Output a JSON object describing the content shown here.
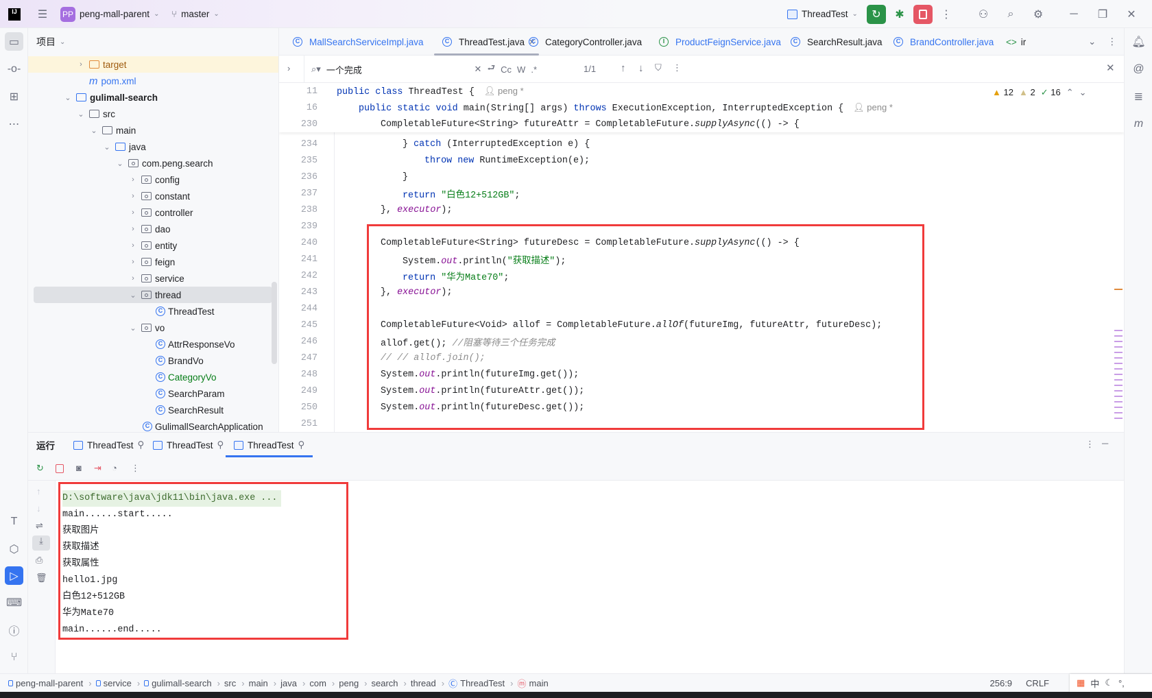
{
  "titlebar": {
    "project_badge": "PP",
    "project": "peng-mall-parent",
    "branch": "master",
    "run_config": "ThreadTest"
  },
  "project_panel": {
    "title": "项目",
    "tree": [
      {
        "label": "target",
        "depth": 1,
        "arrow": "›",
        "icon": "folder-orange",
        "hl": true,
        "color": "#9e5a0d"
      },
      {
        "label": "pom.xml",
        "depth": 1,
        "arrow": "",
        "icon": "maven",
        "color": "#3574f0"
      },
      {
        "label": "gulimall-search",
        "depth": 0,
        "arrow": "⌄",
        "icon": "module",
        "bold": true
      },
      {
        "label": "src",
        "depth": 1,
        "arrow": "⌄",
        "icon": "folder"
      },
      {
        "label": "main",
        "depth": 2,
        "arrow": "⌄",
        "icon": "folder"
      },
      {
        "label": "java",
        "depth": 3,
        "arrow": "⌄",
        "icon": "folder-blue"
      },
      {
        "label": "com.peng.search",
        "depth": 4,
        "arrow": "⌄",
        "icon": "package"
      },
      {
        "label": "config",
        "depth": 5,
        "arrow": "›",
        "icon": "package"
      },
      {
        "label": "constant",
        "depth": 5,
        "arrow": "›",
        "icon": "package"
      },
      {
        "label": "controller",
        "depth": 5,
        "arrow": "›",
        "icon": "package"
      },
      {
        "label": "dao",
        "depth": 5,
        "arrow": "›",
        "icon": "package"
      },
      {
        "label": "entity",
        "depth": 5,
        "arrow": "›",
        "icon": "package"
      },
      {
        "label": "feign",
        "depth": 5,
        "arrow": "›",
        "icon": "package"
      },
      {
        "label": "service",
        "depth": 5,
        "arrow": "›",
        "icon": "package"
      },
      {
        "label": "thread",
        "depth": 5,
        "arrow": "⌄",
        "icon": "package",
        "selected": true
      },
      {
        "label": "ThreadTest",
        "depth": 6,
        "arrow": "",
        "icon": "class-run"
      },
      {
        "label": "vo",
        "depth": 5,
        "arrow": "⌄",
        "icon": "package"
      },
      {
        "label": "AttrResponseVo",
        "depth": 6,
        "arrow": "",
        "icon": "class"
      },
      {
        "label": "BrandVo",
        "depth": 6,
        "arrow": "",
        "icon": "class"
      },
      {
        "label": "CategoryVo",
        "depth": 6,
        "arrow": "",
        "icon": "class",
        "color": "#067d17"
      },
      {
        "label": "SearchParam",
        "depth": 6,
        "arrow": "",
        "icon": "class"
      },
      {
        "label": "SearchResult",
        "depth": 6,
        "arrow": "",
        "icon": "class"
      },
      {
        "label": "GulimallSearchApplication",
        "depth": 5,
        "arrow": "",
        "icon": "class-run"
      }
    ]
  },
  "tabs": [
    {
      "label": "MallSearchServiceImpl.java",
      "icon": "class",
      "color": "#3574f0"
    },
    {
      "label": "ThreadTest.java",
      "icon": "class-run",
      "active": true
    },
    {
      "label": "CategoryController.java",
      "icon": "class"
    },
    {
      "label": "ProductFeignService.java",
      "icon": "interface",
      "color": "#3574f0"
    },
    {
      "label": "SearchResult.java",
      "icon": "class"
    },
    {
      "label": "BrandController.java",
      "icon": "class",
      "color": "#3574f0"
    },
    {
      "label": "ir",
      "icon": "html"
    }
  ],
  "find": {
    "query": "一个完成",
    "case": "Cc",
    "word": "W",
    "regex": ".*",
    "count": "1/1"
  },
  "inspections": {
    "warnings": "12",
    "weak": "2",
    "ok": "16"
  },
  "sticky": [
    {
      "n": "11",
      "indent": 0,
      "t": [
        [
          "public class ",
          "k"
        ],
        [
          "ThreadTest {",
          ""
        ]
      ],
      "author": "peng *"
    },
    {
      "n": "16",
      "indent": 1,
      "t": [
        [
          "public static void ",
          "k"
        ],
        [
          "main",
          ""
        ],
        [
          "(String[] args) ",
          ""
        ],
        [
          "throws ",
          "k"
        ],
        [
          "ExecutionException, InterruptedException {",
          ""
        ]
      ],
      "author": "peng *"
    },
    {
      "n": "230",
      "indent": 2,
      "t": [
        [
          "CompletableFuture<String> futureAttr = CompletableFuture.",
          ""
        ],
        [
          "supplyAsync",
          "i"
        ],
        [
          "(() -> {",
          ""
        ]
      ]
    }
  ],
  "code": [
    {
      "n": "234",
      "indent": 3,
      "t": [
        [
          "} ",
          ""
        ],
        [
          "catch ",
          "k"
        ],
        [
          "(InterruptedException e) {",
          ""
        ]
      ]
    },
    {
      "n": "235",
      "indent": 4,
      "t": [
        [
          "throw new ",
          "k"
        ],
        [
          "RuntimeException(e);",
          ""
        ]
      ]
    },
    {
      "n": "236",
      "indent": 3,
      "t": [
        [
          "}",
          ""
        ]
      ]
    },
    {
      "n": "237",
      "indent": 3,
      "t": [
        [
          "return ",
          "k"
        ],
        [
          "\"白色12+512GB\"",
          "s"
        ],
        [
          ";",
          ""
        ]
      ]
    },
    {
      "n": "238",
      "indent": 2,
      "t": [
        [
          "}, ",
          ""
        ],
        [
          "executor",
          "f"
        ],
        [
          ");",
          ""
        ]
      ]
    },
    {
      "n": "239",
      "indent": 2,
      "t": []
    },
    {
      "n": "240",
      "indent": 2,
      "t": [
        [
          "CompletableFuture<String> futureDesc = CompletableFuture.",
          ""
        ],
        [
          "supplyAsync",
          "i"
        ],
        [
          "(() -> {",
          ""
        ]
      ]
    },
    {
      "n": "241",
      "indent": 3,
      "t": [
        [
          "System.",
          ""
        ],
        [
          "out",
          "f"
        ],
        [
          ".println(",
          ""
        ],
        [
          "\"获取描述\"",
          "s"
        ],
        [
          ");",
          ""
        ]
      ]
    },
    {
      "n": "242",
      "indent": 3,
      "t": [
        [
          "return ",
          "k"
        ],
        [
          "\"华为Mate70\"",
          "s"
        ],
        [
          ";",
          ""
        ]
      ]
    },
    {
      "n": "243",
      "indent": 2,
      "t": [
        [
          "}, ",
          ""
        ],
        [
          "executor",
          "f"
        ],
        [
          ");",
          ""
        ]
      ]
    },
    {
      "n": "244",
      "indent": 2,
      "t": []
    },
    {
      "n": "245",
      "indent": 2,
      "t": [
        [
          "CompletableFuture<Void> allof = CompletableFuture.",
          ""
        ],
        [
          "allOf",
          "i"
        ],
        [
          "(futureImg, futureAttr, futureDesc);",
          ""
        ]
      ]
    },
    {
      "n": "246",
      "indent": 2,
      "t": [
        [
          "allof.get(); ",
          ""
        ],
        [
          "//阻塞等待三个任务完成",
          "c"
        ]
      ]
    },
    {
      "n": "247",
      "indent": 2,
      "t": [
        [
          "// // allof.join();",
          "c"
        ]
      ]
    },
    {
      "n": "248",
      "indent": 2,
      "t": [
        [
          "System.",
          ""
        ],
        [
          "out",
          "f"
        ],
        [
          ".println(futureImg.get());",
          ""
        ]
      ]
    },
    {
      "n": "249",
      "indent": 2,
      "t": [
        [
          "System.",
          ""
        ],
        [
          "out",
          "f"
        ],
        [
          ".println(futureAttr.get());",
          ""
        ]
      ]
    },
    {
      "n": "250",
      "indent": 2,
      "t": [
        [
          "System.",
          ""
        ],
        [
          "out",
          "f"
        ],
        [
          ".println(futureDesc.get());",
          ""
        ]
      ]
    },
    {
      "n": "251",
      "indent": 2,
      "t": []
    }
  ],
  "run_panel": {
    "title": "运行",
    "tabs": [
      "ThreadTest",
      "ThreadTest",
      "ThreadTest"
    ],
    "console": [
      "D:\\software\\java\\jdk11\\bin\\java.exe ...",
      "main......start.....",
      "获取图片",
      "获取描述",
      "获取属性",
      "hello1.jpg",
      "白色12+512GB",
      "华为Mate70",
      "main......end....."
    ]
  },
  "status": {
    "breadcrumb": [
      "peng-mall-parent",
      "service",
      "gulimall-search",
      "src",
      "main",
      "java",
      "com",
      "peng",
      "search",
      "thread",
      "ThreadTest",
      "main"
    ],
    "position": "256:9",
    "line_sep": "CRLF",
    "ime": "中"
  },
  "colors": {
    "accent": "#3574f0",
    "run": "#2b9348",
    "stop": "#e55765",
    "highlight": "#f03b3b"
  }
}
